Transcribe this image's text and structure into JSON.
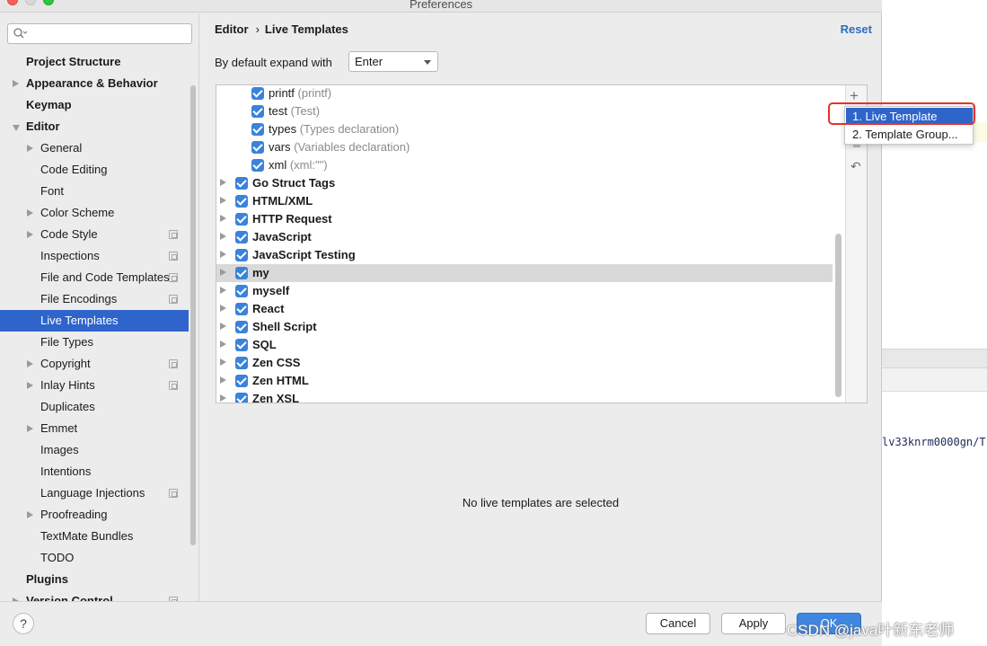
{
  "window": {
    "title": "Preferences"
  },
  "search": {
    "placeholder": ""
  },
  "sidebar": {
    "items": [
      {
        "label": "Project Structure",
        "bold": true,
        "indent": 0,
        "arrow": "none"
      },
      {
        "label": "Appearance & Behavior",
        "bold": true,
        "indent": 0,
        "arrow": "right"
      },
      {
        "label": "Keymap",
        "bold": true,
        "indent": 0,
        "arrow": "none"
      },
      {
        "label": "Editor",
        "bold": true,
        "indent": 0,
        "arrow": "down"
      },
      {
        "label": "General",
        "bold": false,
        "indent": 1,
        "arrow": "right"
      },
      {
        "label": "Code Editing",
        "bold": false,
        "indent": 1,
        "arrow": "none"
      },
      {
        "label": "Font",
        "bold": false,
        "indent": 1,
        "arrow": "none"
      },
      {
        "label": "Color Scheme",
        "bold": false,
        "indent": 1,
        "arrow": "right"
      },
      {
        "label": "Code Style",
        "bold": false,
        "indent": 1,
        "arrow": "right",
        "copy": true
      },
      {
        "label": "Inspections",
        "bold": false,
        "indent": 1,
        "arrow": "none",
        "copy": true
      },
      {
        "label": "File and Code Templates",
        "bold": false,
        "indent": 1,
        "arrow": "none",
        "copy": true
      },
      {
        "label": "File Encodings",
        "bold": false,
        "indent": 1,
        "arrow": "none",
        "copy": true
      },
      {
        "label": "Live Templates",
        "bold": false,
        "indent": 1,
        "arrow": "none",
        "selected": true
      },
      {
        "label": "File Types",
        "bold": false,
        "indent": 1,
        "arrow": "none"
      },
      {
        "label": "Copyright",
        "bold": false,
        "indent": 1,
        "arrow": "right",
        "copy": true
      },
      {
        "label": "Inlay Hints",
        "bold": false,
        "indent": 1,
        "arrow": "right",
        "copy": true
      },
      {
        "label": "Duplicates",
        "bold": false,
        "indent": 1,
        "arrow": "none"
      },
      {
        "label": "Emmet",
        "bold": false,
        "indent": 1,
        "arrow": "right"
      },
      {
        "label": "Images",
        "bold": false,
        "indent": 1,
        "arrow": "none"
      },
      {
        "label": "Intentions",
        "bold": false,
        "indent": 1,
        "arrow": "none"
      },
      {
        "label": "Language Injections",
        "bold": false,
        "indent": 1,
        "arrow": "none",
        "copy": true
      },
      {
        "label": "Proofreading",
        "bold": false,
        "indent": 1,
        "arrow": "right"
      },
      {
        "label": "TextMate Bundles",
        "bold": false,
        "indent": 1,
        "arrow": "none"
      },
      {
        "label": "TODO",
        "bold": false,
        "indent": 1,
        "arrow": "none"
      },
      {
        "label": "Plugins",
        "bold": true,
        "indent": 0,
        "arrow": "none"
      },
      {
        "label": "Version Control",
        "bold": true,
        "indent": 0,
        "arrow": "right",
        "copy": true
      }
    ]
  },
  "header": {
    "breadcrumb_parent": "Editor",
    "breadcrumb_sep": "›",
    "breadcrumb_current": "Live Templates",
    "reset_label": "Reset"
  },
  "expand": {
    "label": "By default expand with",
    "value": "Enter"
  },
  "templates": {
    "rows": [
      {
        "name": "printf",
        "desc": "(printf)",
        "group": false
      },
      {
        "name": "test",
        "desc": "(Test)",
        "group": false
      },
      {
        "name": "types",
        "desc": "(Types declaration)",
        "group": false
      },
      {
        "name": "vars",
        "desc": "(Variables declaration)",
        "group": false
      },
      {
        "name": "xml",
        "desc": "(xml:\"\")",
        "group": false
      },
      {
        "name": "Go Struct Tags",
        "desc": "",
        "group": true
      },
      {
        "name": "HTML/XML",
        "desc": "",
        "group": true
      },
      {
        "name": "HTTP Request",
        "desc": "",
        "group": true
      },
      {
        "name": "JavaScript",
        "desc": "",
        "group": true
      },
      {
        "name": "JavaScript Testing",
        "desc": "",
        "group": true
      },
      {
        "name": "my",
        "desc": "",
        "group": true,
        "selected": true
      },
      {
        "name": "myself",
        "desc": "",
        "group": true
      },
      {
        "name": "React",
        "desc": "",
        "group": true
      },
      {
        "name": "Shell Script",
        "desc": "",
        "group": true
      },
      {
        "name": "SQL",
        "desc": "",
        "group": true
      },
      {
        "name": "Zen CSS",
        "desc": "",
        "group": true
      },
      {
        "name": "Zen HTML",
        "desc": "",
        "group": true
      },
      {
        "name": "Zen XSL",
        "desc": "",
        "group": true
      }
    ],
    "empty_message": "No live templates are selected"
  },
  "toolbar": {
    "add_icon": "+",
    "undo_icon": "↶"
  },
  "popup": {
    "items": [
      {
        "label": "1. Live Template",
        "active": true
      },
      {
        "label": "2. Template Group..."
      }
    ]
  },
  "footer": {
    "help_label": "?",
    "cancel_label": "Cancel",
    "apply_label": "Apply",
    "ok_label": "OK"
  },
  "background": {
    "path_text": "lv33knrm0000gn/T"
  },
  "watermark": "CSDN @java叶新东老师",
  "colors": {
    "accent": "#2f65ca",
    "checkbox": "#3a83da",
    "highlight": "#e8312a",
    "link": "#2d6cc0"
  }
}
